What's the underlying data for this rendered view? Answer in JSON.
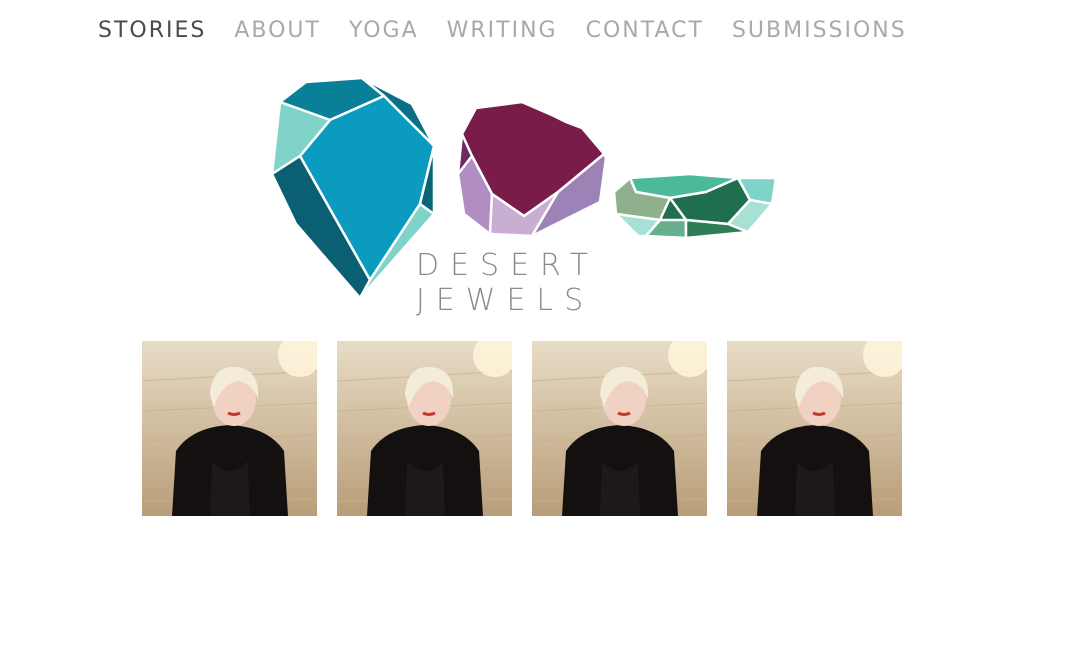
{
  "nav": {
    "items": [
      {
        "label": "STORIES",
        "active": true
      },
      {
        "label": "ABOUT",
        "active": false
      },
      {
        "label": "YOGA",
        "active": false
      },
      {
        "label": "WRITING",
        "active": false
      },
      {
        "label": "CONTACT",
        "active": false
      },
      {
        "label": "SUBMISSIONS",
        "active": false
      }
    ]
  },
  "logo": {
    "text": "DESERT JEWELS",
    "colors": {
      "teal_dark": "#0e6f85",
      "teal": "#0b9bbf",
      "mint": "#7fd3c9",
      "plum": "#7a1c4a",
      "lavender": "#b18ec2",
      "jade": "#1f6e4e",
      "seafoam": "#4cb998",
      "sage": "#8fb08c"
    }
  },
  "gallery": {
    "items": [
      {
        "icon": "portrait-photo"
      },
      {
        "icon": "portrait-photo"
      },
      {
        "icon": "portrait-photo"
      },
      {
        "icon": "portrait-photo"
      }
    ]
  }
}
